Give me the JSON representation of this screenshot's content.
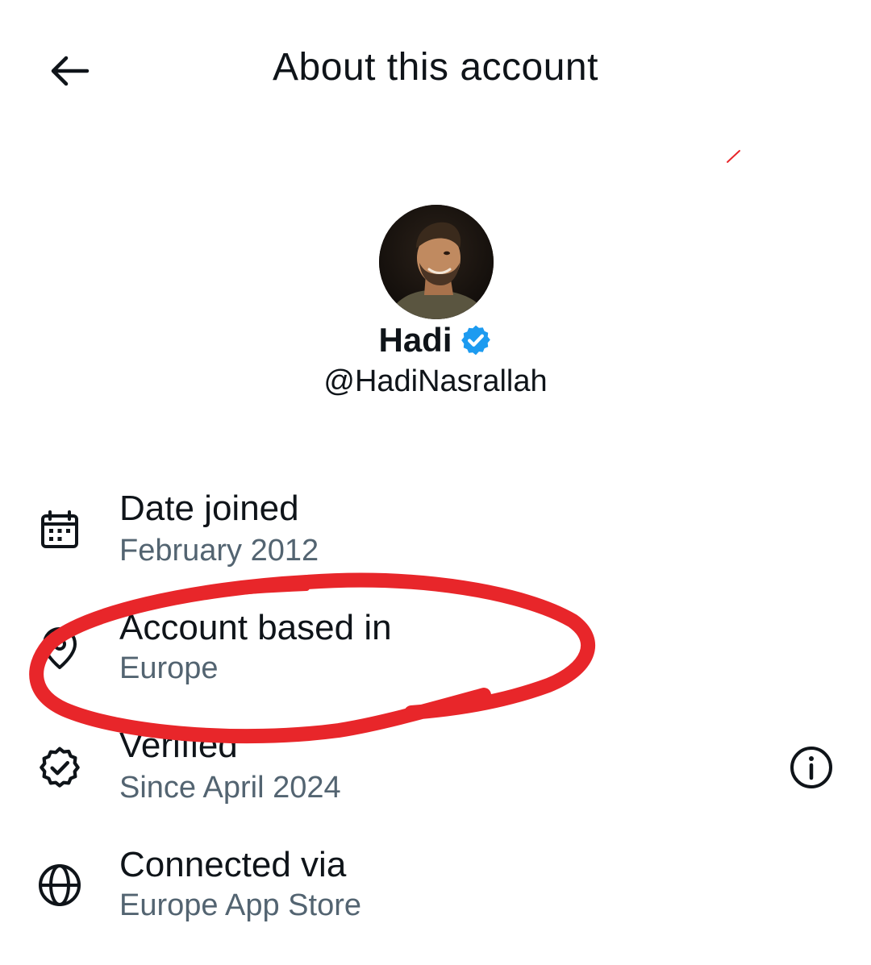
{
  "header": {
    "title": "About this account",
    "back_icon": "arrow-left-icon"
  },
  "profile": {
    "display_name": "Hadi",
    "handle": "@HadiNasrallah",
    "verified_badge_color": "#1d9bf0"
  },
  "rows": [
    {
      "icon": "calendar-icon",
      "label": "Date joined",
      "value": "February 2012"
    },
    {
      "icon": "location-pin-icon",
      "label": "Account based in",
      "value": "Europe"
    },
    {
      "icon": "verified-badge-icon",
      "label": "Verified",
      "value": "Since April 2024",
      "trailing_icon": "info-icon"
    },
    {
      "icon": "globe-icon",
      "label": "Connected via",
      "value": "Europe App Store"
    }
  ],
  "colors": {
    "primary_text": "#0f1419",
    "secondary_text": "#536471",
    "annotation_red": "#e8262a"
  }
}
